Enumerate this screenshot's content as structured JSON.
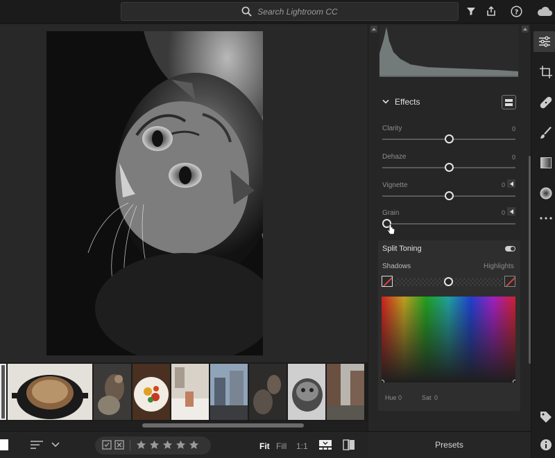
{
  "search": {
    "placeholder": "Search Lightroom CC"
  },
  "effects": {
    "title": "Effects",
    "sliders": [
      {
        "label": "Clarity",
        "value": "0"
      },
      {
        "label": "Dehaze",
        "value": "0"
      },
      {
        "label": "Vignette",
        "value": "0"
      },
      {
        "label": "Grain",
        "value": "0"
      }
    ]
  },
  "split_toning": {
    "title": "Split Toning",
    "shadows_label": "Shadows",
    "highlights_label": "Highlights",
    "hue_label": "Hue",
    "hue_value": "0",
    "sat_label": "Sat",
    "sat_value": "0"
  },
  "bottom": {
    "fit": "Fit",
    "fill": "Fill",
    "one_to_one": "1:1",
    "rating_max": 5
  },
  "presets_label": "Presets",
  "colors": {
    "background": "#1f1f1f",
    "panel": "#262626",
    "accent_red": "#d9453a"
  },
  "icons": {
    "topbar": [
      "search-icon",
      "filter-icon",
      "share-icon",
      "help-icon",
      "cloud-icon"
    ],
    "toolstrip": [
      "edit-sliders-icon",
      "crop-icon",
      "healing-icon",
      "brush-icon",
      "linear-gradient-icon",
      "radial-gradient-icon",
      "more-icon",
      "tag-icon",
      "info-icon"
    ]
  }
}
